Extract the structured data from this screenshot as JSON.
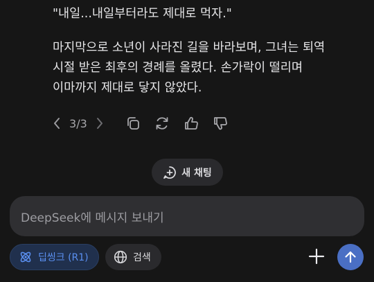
{
  "message": {
    "paragraphs": [
      "\"내일...내일부터라도 제대로 먹자.\"",
      "마지막으로 소년이 사라진 길을 바라보며, 그녀는 퇴역\n시절 받은 최후의 경례를 올렸다. 손가락이 떨리며\n이마까지 제대로 닿지 않았다."
    ]
  },
  "pager": {
    "current": "3",
    "separator": "/",
    "total": "3"
  },
  "message_actions": [
    {
      "name": "copy-icon"
    },
    {
      "name": "regenerate-icon"
    },
    {
      "name": "thumbs-up-icon"
    },
    {
      "name": "thumbs-down-icon"
    }
  ],
  "new_chat": {
    "label": "새 채팅",
    "icon": "new-chat-icon"
  },
  "composer": {
    "placeholder": "DeepSeek에 메시지 보내기"
  },
  "toolbar": {
    "deepthink_label": "딥씽크 (R1)",
    "deepthink_icon": "atom-icon",
    "search_label": "검색",
    "search_icon": "globe-icon",
    "attach_icon": "plus-icon",
    "send_icon": "arrow-up-icon"
  },
  "colors": {
    "background": "#161616",
    "accent": "#4a6fc4",
    "deepthink_text": "#5a8ff0",
    "input_bg": "#2f2f32"
  }
}
